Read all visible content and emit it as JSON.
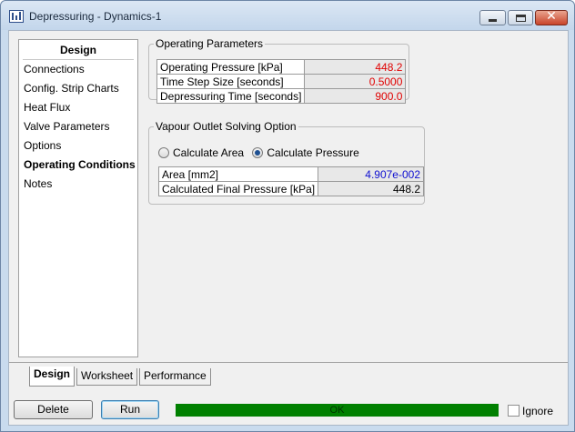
{
  "window": {
    "title": "Depressuring - Dynamics-1",
    "close_glyph": "✕"
  },
  "nav": {
    "header": "Design",
    "items": [
      "Connections",
      "Config. Strip Charts",
      "Heat Flux",
      "Valve Parameters",
      "Options",
      "Operating Conditions",
      "Notes"
    ],
    "active": "Operating Conditions"
  },
  "operating_parameters": {
    "title": "Operating Parameters",
    "rows": [
      {
        "label": "Operating Pressure [kPa]",
        "value": "448.2"
      },
      {
        "label": "Time Step Size [seconds]",
        "value": "0.5000"
      },
      {
        "label": "Depressuring Time [seconds]",
        "value": "900.0"
      }
    ],
    "value_color": "#e00000"
  },
  "vapour_outlet": {
    "title": "Vapour Outlet Solving Option",
    "options": [
      "Calculate Area",
      "Calculate Pressure"
    ],
    "selected": "Calculate Pressure",
    "rows": [
      {
        "label": "Area [mm2]",
        "value": "4.907e-002"
      },
      {
        "label": "Calculated Final Pressure [kPa]",
        "value": "448.2"
      }
    ]
  },
  "tabs": [
    "Design",
    "Worksheet",
    "Performance"
  ],
  "active_tab": "Design",
  "buttons": {
    "delete": "Delete",
    "run": "Run"
  },
  "status": {
    "text": "OK",
    "color": "#008000"
  },
  "ignore": {
    "label": "Ignore",
    "checked": false
  },
  "icons": [
    "app-icon",
    "minimize-icon",
    "maximize-icon",
    "close-icon"
  ]
}
